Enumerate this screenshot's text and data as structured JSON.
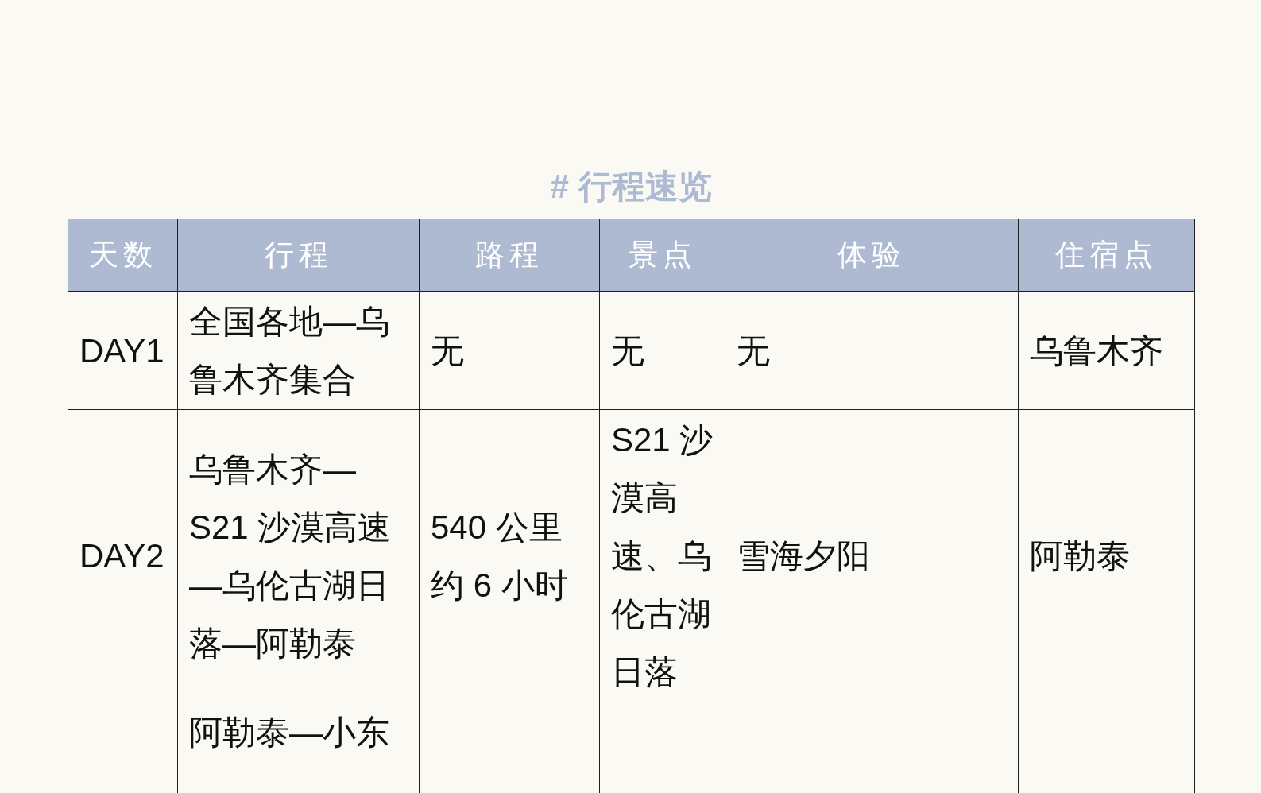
{
  "heading": "# 行程速览",
  "table": {
    "columns": [
      "天数",
      "行程",
      "路程",
      "景点",
      "体验",
      "住宿点"
    ],
    "rows": [
      {
        "day": "DAY1",
        "route": "全国各地—乌鲁木齐集合",
        "distance": "无",
        "sights": "无",
        "experience": "无",
        "lodging": "乌鲁木齐"
      },
      {
        "day": "DAY2",
        "route": "乌鲁木齐—S21 沙漠高速—乌伦古湖日落—阿勒泰",
        "distance": "540 公里约 6 小时",
        "sights": "S21 沙漠高速、乌伦古湖日落",
        "experience": "雪海夕阳",
        "lodging": "阿勒泰"
      },
      {
        "route": "阿勒泰—小东"
      }
    ]
  }
}
